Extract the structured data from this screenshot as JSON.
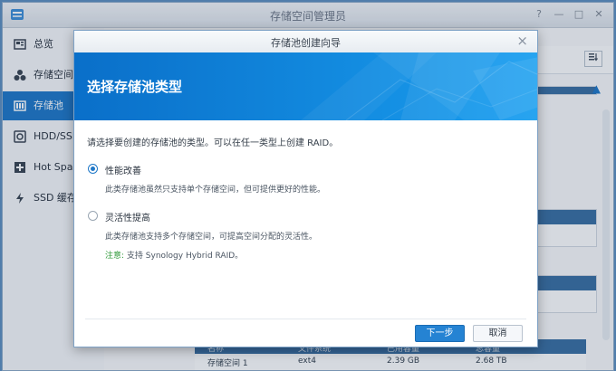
{
  "app": {
    "title": "存储空间管理员",
    "controls": [
      "?",
      "—",
      "□",
      "✕"
    ]
  },
  "sidebar": {
    "items": [
      {
        "label": "总览",
        "icon": "overview-icon"
      },
      {
        "label": "存储空间",
        "icon": "storage-icon"
      },
      {
        "label": "存储池",
        "icon": "storage-pool-icon",
        "active": true
      },
      {
        "label": "HDD/SSD",
        "icon": "hdd-icon"
      },
      {
        "label": "Hot Spare",
        "icon": "hot-spare-icon"
      },
      {
        "label": "SSD 缓存",
        "icon": "ssd-cache-icon"
      }
    ]
  },
  "background_table": {
    "headers": [
      "名称",
      "文件系统",
      "已用容量",
      "总容量"
    ],
    "row": [
      "存储空间 1",
      "ext4",
      "2.39 GB",
      "2.68 TB"
    ]
  },
  "dialog": {
    "title": "存储池创建向导",
    "close": "×",
    "banner_title": "选择存储池类型",
    "intro": "请选择要创建的存储池的类型。可以在任一类型上创建 RAID。",
    "options": [
      {
        "label": "性能改善",
        "desc": "此类存储池虽然只支持单个存储空间，但可提供更好的性能。",
        "selected": true
      },
      {
        "label": "灵活性提高",
        "desc": "此类存储池支持多个存储空间，可提高空间分配的灵活性。",
        "selected": false
      }
    ],
    "note_label": "注意:",
    "note_text": "支持 Synology Hybrid RAID。",
    "buttons": {
      "next": "下一步",
      "cancel": "取消"
    }
  },
  "colors": {
    "accent": "#1f78c8",
    "banner": "#0a6fc9",
    "note": "#2f9a3a"
  }
}
